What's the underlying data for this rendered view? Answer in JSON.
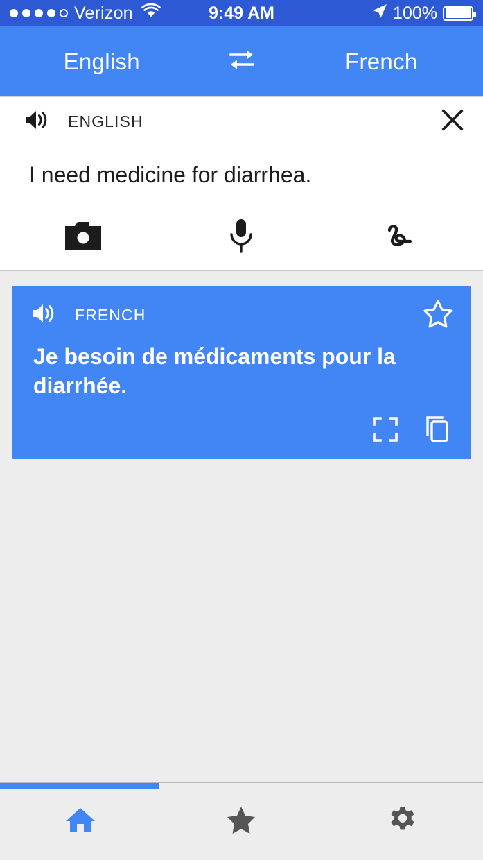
{
  "status_bar": {
    "signal_dots_filled": 4,
    "signal_dots_total": 5,
    "carrier": "Verizon",
    "wifi_icon": "wifi-icon",
    "time": "9:49 AM",
    "location_icon": "location-arrow-icon",
    "battery_percent": "100%",
    "battery_level": 100,
    "background_color": "#2d5ad4"
  },
  "language_bar": {
    "source_language": "English",
    "target_language": "French",
    "swap_icon": "swap-arrows-icon",
    "background_color": "#4285f4"
  },
  "source_card": {
    "speaker_icon": "speaker-icon",
    "language_label": "ENGLISH",
    "close_icon": "close-icon",
    "text": "I need medicine for diarrhea.",
    "input_methods": [
      {
        "name": "camera",
        "icon": "camera-icon"
      },
      {
        "name": "voice",
        "icon": "microphone-icon"
      },
      {
        "name": "handwriting",
        "icon": "handwriting-icon"
      }
    ]
  },
  "translation_card": {
    "speaker_icon": "speaker-icon",
    "language_label": "FRENCH",
    "star_icon": "star-outline-icon",
    "text": "Je besoin de médicaments pour la diarrhée.",
    "actions": [
      {
        "name": "fullscreen",
        "icon": "fullscreen-icon"
      },
      {
        "name": "copy",
        "icon": "copy-icon"
      }
    ],
    "background_color": "#4285f4"
  },
  "progress_bar": {
    "percent": 33,
    "color": "#4285f4"
  },
  "tab_bar": {
    "items": [
      {
        "name": "home",
        "icon": "home-icon",
        "active": true
      },
      {
        "name": "starred",
        "icon": "star-filled-icon",
        "active": false
      },
      {
        "name": "settings",
        "icon": "gear-icon",
        "active": false
      }
    ],
    "active_color": "#4285f4",
    "inactive_color": "#555555"
  }
}
